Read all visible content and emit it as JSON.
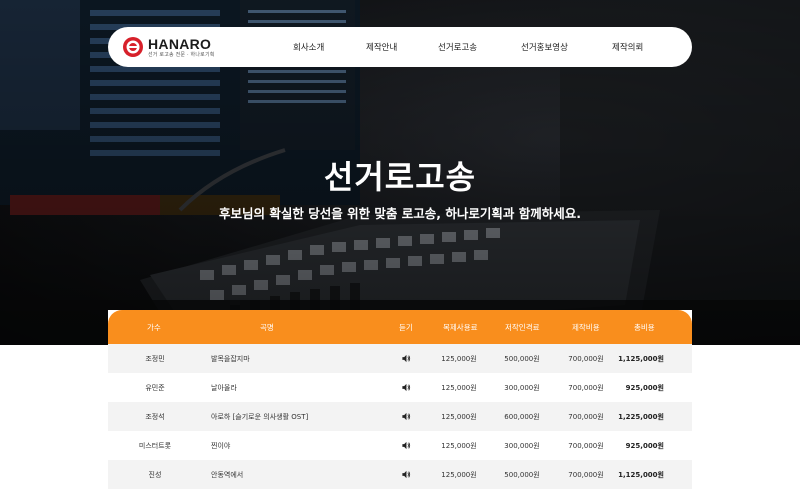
{
  "brand": {
    "name": "HANARO",
    "tagline": "선거 로고송 전문 · 하나로기획",
    "logo_color": "#d7202a"
  },
  "nav": {
    "items": [
      {
        "label": "회사소개"
      },
      {
        "label": "제작안내"
      },
      {
        "label": "선거로고송"
      },
      {
        "label": "선거홍보영상"
      },
      {
        "label": "제작의뢰"
      }
    ]
  },
  "hero": {
    "title": "선거로고송",
    "subtitle": "후보님의 확실한 당선을 위한 맞춤 로고송, 하나로기획과 함께하세요."
  },
  "table": {
    "header_color": "#f98e1d",
    "columns": [
      "가수",
      "곡명",
      "듣기",
      "복제사용료",
      "저작인격료",
      "제작비용",
      "총비용"
    ],
    "rows": [
      {
        "singer": "조정민",
        "song": "발목을잡지마",
        "play_icon": "speaker-icon",
        "copy_fee": "125,000원",
        "moral_fee": "500,000원",
        "production_fee": "700,000원",
        "total": "1,125,000원"
      },
      {
        "singer": "유민준",
        "song": "날아올라",
        "play_icon": "speaker-icon",
        "copy_fee": "125,000원",
        "moral_fee": "300,000원",
        "production_fee": "700,000원",
        "total": "925,000원"
      },
      {
        "singer": "조정석",
        "song": "아로하 [슬기로운 의사생활 OST]",
        "play_icon": "speaker-icon",
        "copy_fee": "125,000원",
        "moral_fee": "600,000원",
        "production_fee": "700,000원",
        "total": "1,225,000원"
      },
      {
        "singer": "미스터트롯",
        "song": "찐이야",
        "play_icon": "speaker-icon",
        "copy_fee": "125,000원",
        "moral_fee": "300,000원",
        "production_fee": "700,000원",
        "total": "925,000원"
      },
      {
        "singer": "진성",
        "song": "안동역에서",
        "play_icon": "speaker-icon",
        "copy_fee": "125,000원",
        "moral_fee": "500,000원",
        "production_fee": "700,000원",
        "total": "1,125,000원"
      }
    ]
  }
}
